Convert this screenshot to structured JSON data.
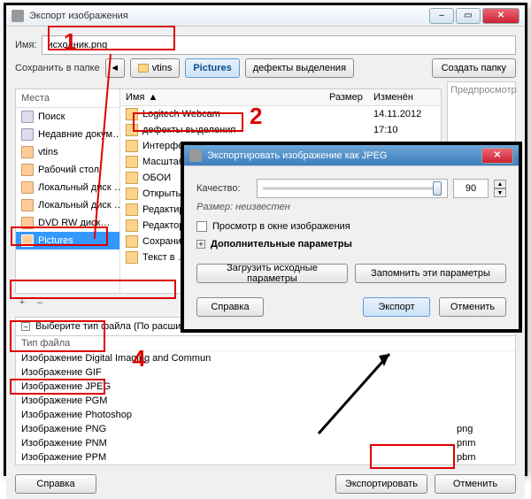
{
  "main": {
    "title": "Экспорт изображения",
    "name_label": "Имя:",
    "filename": "исходник.png",
    "save_in_label": "Сохранить в папке",
    "path": [
      "vtins",
      "Pictures",
      "дефекты выделения"
    ],
    "create_folder": "Создать папку",
    "places_header": "Места",
    "places": [
      {
        "label": "Поиск",
        "sys": true
      },
      {
        "label": "Недавние докум…",
        "sys": true
      },
      {
        "label": "vtins",
        "sys": false
      },
      {
        "label": "Рабочий стол",
        "sys": false
      },
      {
        "label": "Локальный диск …",
        "sys": false
      },
      {
        "label": "Локальный диск …",
        "sys": false
      },
      {
        "label": "DVD RW диск…",
        "sys": false
      },
      {
        "label": "Pictures",
        "sys": false,
        "selected": true
      }
    ],
    "list_headers": {
      "name": "Имя",
      "size": "Размер",
      "date": "Изменён"
    },
    "files": [
      {
        "name": "Logitech Webcam",
        "size": "",
        "date": "14.11.2012"
      },
      {
        "name": "дефекты выделения",
        "size": "",
        "date": "17:10"
      },
      {
        "name": "Интерфейс",
        "size": "",
        "date": ""
      },
      {
        "name": "Масштаб",
        "size": "",
        "date": ""
      },
      {
        "name": "ОБОИ",
        "size": "",
        "date": ""
      },
      {
        "name": "Открыть диал…",
        "size": "",
        "date": ""
      },
      {
        "name": "Редактирован…",
        "size": "",
        "date": ""
      },
      {
        "name": "Редактор каж…",
        "size": "",
        "date": ""
      },
      {
        "name": "Сохранить в…",
        "size": "",
        "date": ""
      },
      {
        "name": "Текст в …",
        "size": "",
        "date": ""
      }
    ],
    "preview_label": "Предпросмотр",
    "filetype_expander": "Выберите тип файла (По расширению)",
    "type_header_left": "Тип файла",
    "types": [
      {
        "name": "Изображение Digital Imaging and Commun",
        "ext": ""
      },
      {
        "name": "Изображение GIF",
        "ext": ""
      },
      {
        "name": "Изображение JPEG",
        "ext": ""
      },
      {
        "name": "Изображение PGM",
        "ext": ""
      },
      {
        "name": "Изображение Photoshop",
        "ext": ""
      },
      {
        "name": "Изображение PNG",
        "ext": "png"
      },
      {
        "name": "Изображение PNM",
        "ext": "pnm"
      },
      {
        "name": "Изображение PPM",
        "ext": "pbm"
      }
    ],
    "help_btn": "Справка",
    "export_btn": "Экспортировать",
    "cancel_btn": "Отменить"
  },
  "modal": {
    "title": "Экспортировать изображение как JPEG",
    "quality_label": "Качество:",
    "quality_value": "90",
    "size_label": "Размер: неизвестен",
    "preview_check": "Просмотр в окне изображения",
    "more_params": "Дополнительные параметры",
    "load_defaults": "Загрузить исходные параметры",
    "save_defaults": "Запомнить эти параметры",
    "help_btn": "Справка",
    "export_btn": "Экспорт",
    "cancel_btn": "Отменить"
  },
  "annotations": {
    "n1": "1",
    "n2": "2",
    "n4": "4"
  }
}
